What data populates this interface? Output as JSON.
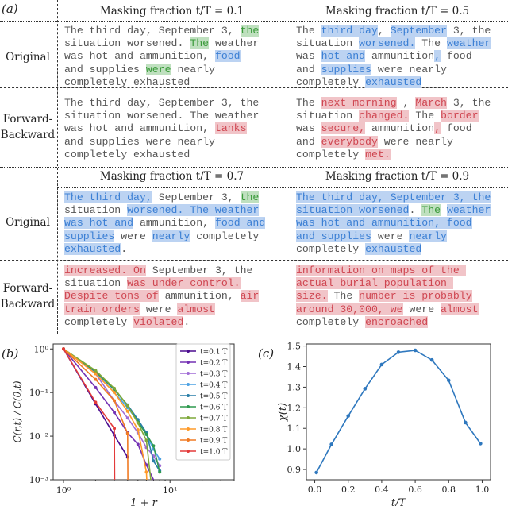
{
  "figure": {
    "panel_a_label": "(a)",
    "panel_b_label": "(b)",
    "panel_c_label": "(c)",
    "column_headers": [
      "Masking fraction t/T = 0.1",
      "Masking fraction t/T = 0.5",
      "Masking fraction t/T = 0.7",
      "Masking fraction t/T = 0.9"
    ],
    "row_labels": {
      "original": "Original",
      "forward_backward_1": "Forward-",
      "forward_backward_2": "Backward"
    },
    "highlight_colors": {
      "masked_blue": "#bcd3f2",
      "kept_green": "#bfe0bf",
      "changed_red": "#f1c4c8"
    },
    "cells": [
      {
        "id": "t01-original",
        "segments": [
          [
            "k",
            "The third day, September 3, "
          ],
          [
            "g",
            "the"
          ],
          [
            "k",
            "\nsituation worsened. "
          ],
          [
            "g",
            "The"
          ],
          [
            "k",
            " weather\nwas hot and ammunition, "
          ],
          [
            "b",
            "food"
          ],
          [
            "k",
            "\nand supplies "
          ],
          [
            "g",
            "were"
          ],
          [
            "k",
            " nearly\ncompletely exhausted"
          ]
        ]
      },
      {
        "id": "t05-original",
        "segments": [
          [
            "k",
            "The "
          ],
          [
            "b",
            "third day"
          ],
          [
            "k",
            ", "
          ],
          [
            "b",
            "September"
          ],
          [
            "k",
            " 3, the\nsituation "
          ],
          [
            "b",
            "worsened."
          ],
          [
            "k",
            " The "
          ],
          [
            "b",
            "weather"
          ],
          [
            "k",
            "\nwas "
          ],
          [
            "b",
            "hot and"
          ],
          [
            "k",
            " ammunition"
          ],
          [
            "b",
            ","
          ],
          [
            "k",
            " food\nand "
          ],
          [
            "b",
            "supplies"
          ],
          [
            "k",
            " were nearly\ncompletely "
          ],
          [
            "b",
            "exhausted"
          ]
        ]
      },
      {
        "id": "t01-forward-backward",
        "segments": [
          [
            "k",
            "The third day, September 3, the\nsituation worsened. The weather\nwas hot and ammunition, "
          ],
          [
            "r",
            "tanks"
          ],
          [
            "k",
            "\nand supplies were nearly\ncompletely exhausted"
          ]
        ]
      },
      {
        "id": "t05-forward-backward",
        "segments": [
          [
            "k",
            "The "
          ],
          [
            "r",
            "next morning"
          ],
          [
            "k",
            " , "
          ],
          [
            "r",
            "March"
          ],
          [
            "k",
            " 3, the\nsituation "
          ],
          [
            "r",
            "changed."
          ],
          [
            "k",
            " The "
          ],
          [
            "r",
            "border"
          ],
          [
            "k",
            "\nwas "
          ],
          [
            "r",
            "secure,"
          ],
          [
            "k",
            " ammunition"
          ],
          [
            "r",
            ","
          ],
          [
            "k",
            " food\nand "
          ],
          [
            "r",
            "everybody"
          ],
          [
            "k",
            " were nearly\ncompletely "
          ],
          [
            "r",
            "met."
          ]
        ]
      },
      {
        "id": "t07-original",
        "segments": [
          [
            "b",
            "The third day,"
          ],
          [
            "k",
            " September 3, "
          ],
          [
            "g",
            "the"
          ],
          [
            "k",
            "\nsituation "
          ],
          [
            "b",
            "worsened. The weather"
          ],
          [
            "k",
            "\n"
          ],
          [
            "b",
            "was hot and"
          ],
          [
            "k",
            " ammunition, "
          ],
          [
            "b",
            "food and"
          ],
          [
            "k",
            "\n"
          ],
          [
            "b",
            "supplies"
          ],
          [
            "k",
            " were "
          ],
          [
            "b",
            "nearly"
          ],
          [
            "k",
            " completely\n"
          ],
          [
            "b",
            "exhausted"
          ],
          [
            "k",
            "."
          ]
        ]
      },
      {
        "id": "t09-original",
        "segments": [
          [
            "b",
            "The third day, September 3, the"
          ],
          [
            "k",
            "\n"
          ],
          [
            "b",
            "situation worsened"
          ],
          [
            "w",
            "."
          ],
          [
            "k",
            " "
          ],
          [
            "g",
            "The"
          ],
          [
            "k",
            " "
          ],
          [
            "b",
            "weather"
          ],
          [
            "k",
            "\n"
          ],
          [
            "b",
            "was hot and ammunition, food"
          ],
          [
            "k",
            "\n"
          ],
          [
            "b",
            "and supplies"
          ],
          [
            "w",
            " were "
          ],
          [
            "b",
            "nearly"
          ],
          [
            "k",
            "\ncompletely "
          ],
          [
            "b",
            "exhausted"
          ]
        ]
      },
      {
        "id": "t07-forward-backward",
        "segments": [
          [
            "r",
            "increased. On"
          ],
          [
            "k",
            " September 3, the\nsituation "
          ],
          [
            "r",
            "was under control."
          ],
          [
            "k",
            "\n"
          ],
          [
            "r",
            "Despite tons of"
          ],
          [
            "k",
            " ammunition, "
          ],
          [
            "r",
            "air"
          ],
          [
            "k",
            "\n"
          ],
          [
            "r",
            "train orders"
          ],
          [
            "k",
            " were "
          ],
          [
            "r",
            "almost"
          ],
          [
            "k",
            "\ncompletely "
          ],
          [
            "r",
            "violated"
          ],
          [
            "k",
            "."
          ]
        ]
      },
      {
        "id": "t09-forward-backward",
        "segments": [
          [
            "r",
            "information on maps of the "
          ],
          [
            "k",
            "\n"
          ],
          [
            "r",
            "actual burial population "
          ],
          [
            "k",
            "\n"
          ],
          [
            "r",
            "size."
          ],
          [
            "w",
            " The "
          ],
          [
            "r",
            "number is probably"
          ],
          [
            "k",
            "\n"
          ],
          [
            "r",
            "around 30,000, we"
          ],
          [
            "w",
            " were "
          ],
          [
            "r",
            "almost"
          ],
          [
            "k",
            "\ncompletely "
          ],
          [
            "r",
            "encroached"
          ]
        ]
      }
    ]
  },
  "chart_data": [
    {
      "type": "line",
      "panel": "(b)",
      "title": "",
      "xlabel": "1 + r",
      "ylabel": "C(r,t) / C(0,t)",
      "xscale": "log",
      "yscale": "log",
      "xlim": [
        0.8,
        40
      ],
      "ylim": [
        0.001,
        1.3
      ],
      "xticks": [
        "10^0",
        "10^1"
      ],
      "yticks": [
        "10^-3",
        "10^-2",
        "10^-1",
        "10^0"
      ],
      "legend_position": "upper-right",
      "series": [
        {
          "name": "t=0.1 T",
          "color": "#4b0c8f",
          "x": [
            1,
            2,
            3,
            4
          ],
          "y": [
            1.0,
            0.055,
            0.0105,
            0.0033
          ]
        },
        {
          "name": "t=0.2 T",
          "color": "#7431b4",
          "x": [
            1,
            2,
            3,
            4,
            5,
            6,
            7
          ],
          "y": [
            1.0,
            0.13,
            0.035,
            0.012,
            0.0065,
            0.0022,
            0.0006
          ]
        },
        {
          "name": "t=0.3 T",
          "color": "#a06cd5",
          "x": [
            1,
            2,
            3,
            4,
            5,
            6,
            7,
            8
          ],
          "y": [
            1.0,
            0.27,
            0.065,
            0.026,
            0.012,
            0.0055,
            0.0035,
            0.0021
          ]
        },
        {
          "name": "t=0.4 T",
          "color": "#4da2e3",
          "x": [
            1,
            2,
            3,
            4,
            5,
            6,
            7,
            8
          ],
          "y": [
            1.0,
            0.28,
            0.1,
            0.045,
            0.022,
            0.011,
            0.005,
            0.003
          ]
        },
        {
          "name": "t=0.5 T",
          "color": "#2a7fa8",
          "x": [
            1,
            2,
            3,
            4,
            5,
            6,
            7,
            8
          ],
          "y": [
            1.0,
            0.3,
            0.115,
            0.052,
            0.024,
            0.012,
            0.0027,
            0.0016
          ]
        },
        {
          "name": "t=0.6 T",
          "color": "#2f9a4f",
          "x": [
            1,
            2,
            3,
            4,
            5,
            6,
            7,
            8
          ],
          "y": [
            1.0,
            0.31,
            0.12,
            0.05,
            0.021,
            0.011,
            0.006,
            0.0015
          ]
        },
        {
          "name": "t=0.7 T",
          "color": "#7fa83a",
          "x": [
            1,
            2,
            3,
            4,
            5,
            6,
            6.6
          ],
          "y": [
            1.0,
            0.32,
            0.125,
            0.05,
            0.02,
            0.008,
            0.0007
          ]
        },
        {
          "name": "t=0.8 T",
          "color": "#ff9b2a",
          "x": [
            1,
            2,
            3,
            4,
            5,
            6,
            6.05
          ],
          "y": [
            1.0,
            0.27,
            0.1,
            0.037,
            0.014,
            0.0015,
            0.0007
          ]
        },
        {
          "name": "t=0.9 T",
          "color": "#f07a23",
          "x": [
            1,
            2,
            3,
            4,
            4.02
          ],
          "y": [
            1.0,
            0.2,
            0.065,
            0.0115,
            0.0007
          ]
        },
        {
          "name": "t=1.0 T",
          "color": "#e33a3a",
          "x": [
            1,
            2,
            3,
            3.02
          ],
          "y": [
            1.0,
            0.06,
            0.015,
            0.0007
          ]
        }
      ]
    },
    {
      "type": "line",
      "panel": "(c)",
      "title": "",
      "xlabel": "t/T",
      "ylabel": "χ(t)",
      "xlim": [
        -0.05,
        1.05
      ],
      "ylim": [
        0.85,
        1.51
      ],
      "xticks": [
        "0.0",
        "0.2",
        "0.4",
        "0.6",
        "0.8",
        "1.0"
      ],
      "yticks": [
        "0.9",
        "1.0",
        "1.1",
        "1.2",
        "1.3",
        "1.4",
        "1.5"
      ],
      "series": [
        {
          "name": "χ(t)",
          "color": "#2f78be",
          "x": [
            0.01,
            0.1,
            0.2,
            0.3,
            0.4,
            0.5,
            0.6,
            0.7,
            0.8,
            0.9,
            0.99
          ],
          "y": [
            0.885,
            1.022,
            1.16,
            1.292,
            1.41,
            1.47,
            1.479,
            1.432,
            1.333,
            1.128,
            1.026
          ]
        }
      ]
    }
  ]
}
